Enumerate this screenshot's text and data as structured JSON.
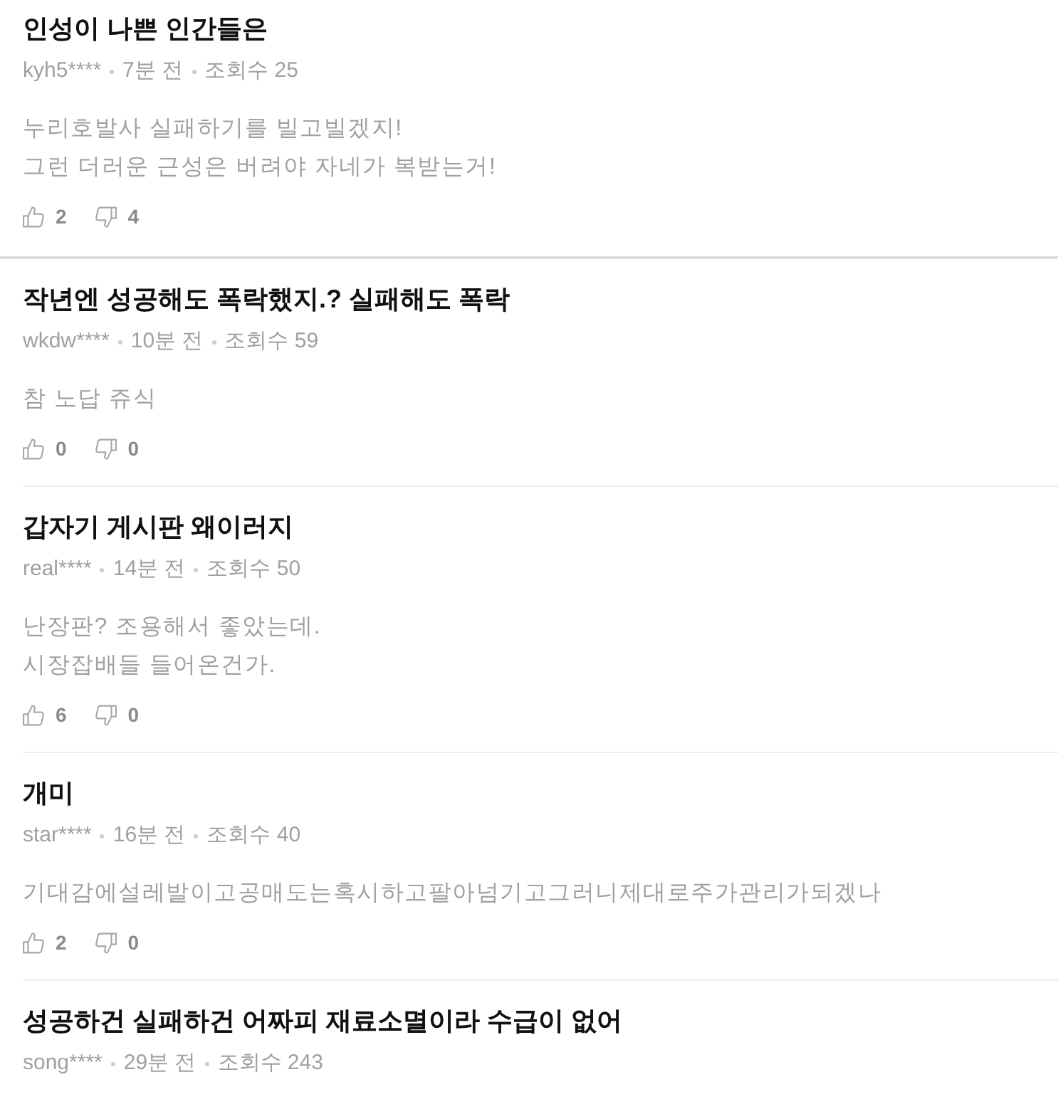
{
  "posts": [
    {
      "title": "인성이 나쁜 인간들은",
      "author": "kyh5****",
      "time": "7분 전",
      "views": "조회수 25",
      "body": "누리호발사 실패하기를 빌고빌겠지!\n그런 더러운 근성은 버려야 자네가 복받는거!",
      "likes": "2",
      "dislikes": "4"
    },
    {
      "title": "작년엔 성공해도 폭락했지.? 실패해도 폭락",
      "author": "wkdw****",
      "time": "10분 전",
      "views": "조회수 59",
      "body": "참 노답 쥬식",
      "likes": "0",
      "dislikes": "0"
    },
    {
      "title": "갑자기 게시판 왜이러지",
      "author": "real****",
      "time": "14분 전",
      "views": "조회수 50",
      "body": "난장판? 조용해서 좋았는데.\n시장잡배들 들어온건가.",
      "likes": "6",
      "dislikes": "0"
    },
    {
      "title": "개미",
      "author": "star****",
      "time": "16분 전",
      "views": "조회수 40",
      "body": "기대감에설레발이고공매도는혹시하고팔아넘기고그러니제대로주가관리가되겠나",
      "likes": "2",
      "dislikes": "0"
    },
    {
      "title": "성공하건 실패하건 어짜피 재료소멸이라 수급이 없어",
      "author": "song****",
      "time": "29분 전",
      "views": "조회수 243"
    }
  ]
}
